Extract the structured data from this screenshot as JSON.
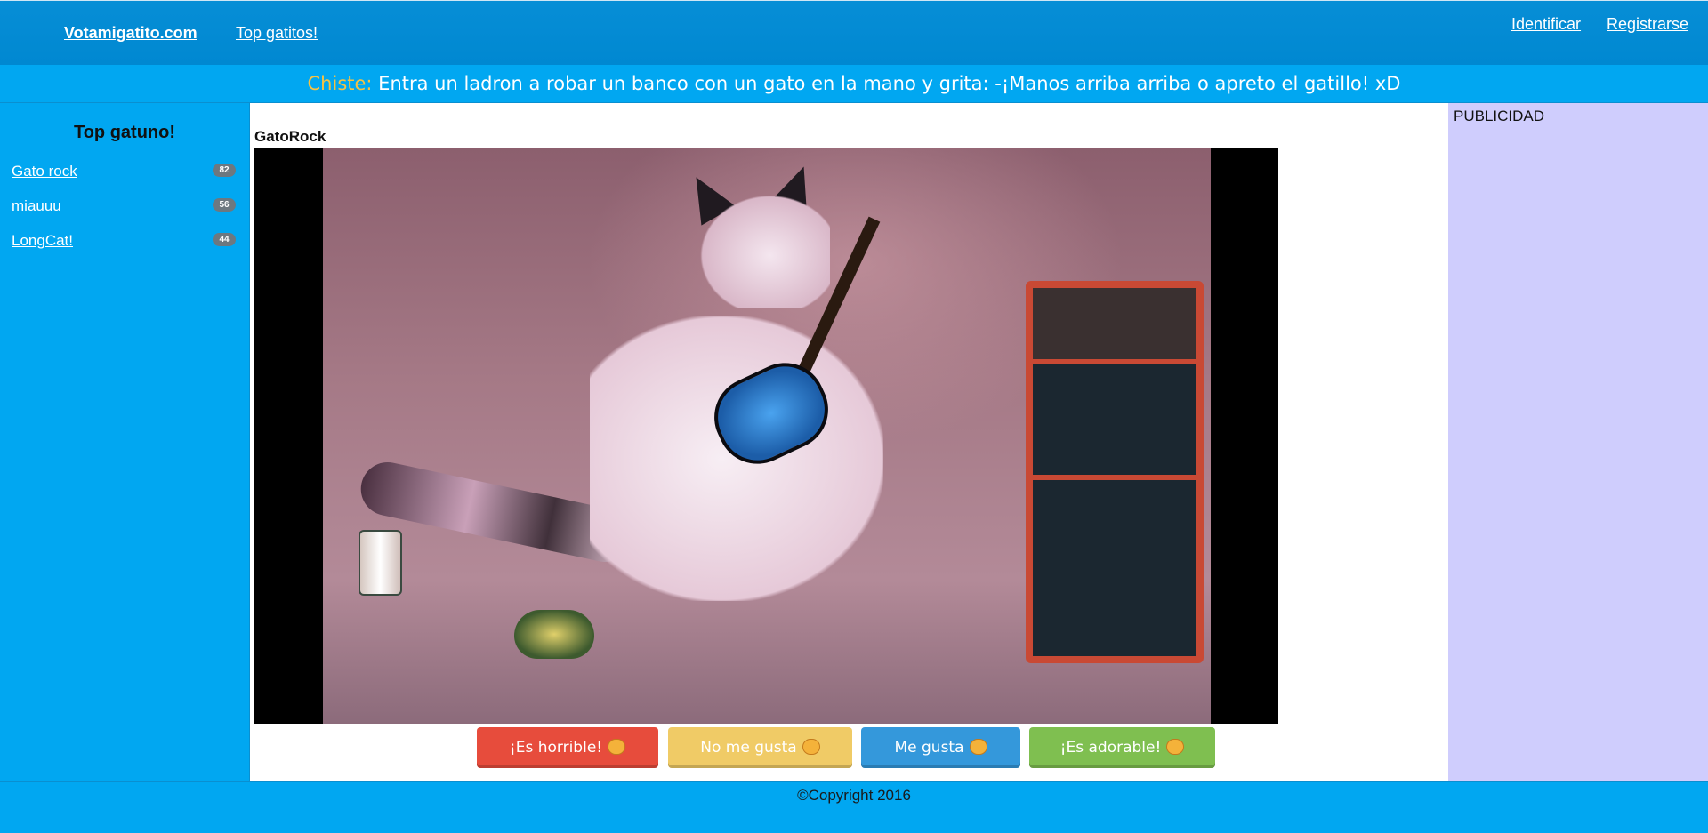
{
  "navbar": {
    "brand": "Votamigatito.com",
    "top_link": "Top gatitos!",
    "login": "Identificar",
    "register": "Registrarse"
  },
  "joke": {
    "label": "Chiste:",
    "text": " Entra un ladron a robar un banco con un gato en la mano y grita: -¡Manos arriba arriba o apreto el gatillo! xD"
  },
  "sidebar": {
    "title": "Top gatuno!",
    "items": [
      {
        "label": "Gato rock",
        "votes": "82"
      },
      {
        "label": "miauuu",
        "votes": "56"
      },
      {
        "label": "LongCat!",
        "votes": "44"
      }
    ]
  },
  "main": {
    "cat_title": "GatoRock",
    "image_alt": "cat-playing-guitar"
  },
  "votes": {
    "horrible": "¡Es horrible!",
    "no_me_gusta": "No me gusta",
    "me_gusta": "Me gusta",
    "adorable": "¡Es adorable!"
  },
  "ads": {
    "label": "PUBLICIDAD"
  },
  "footer": {
    "copyright": "©Copyright 2016"
  },
  "colors": {
    "nav": "#0088d1",
    "banner": "#01a7f1",
    "ads": "#cfcdfd",
    "joke_label": "#f6c343"
  }
}
